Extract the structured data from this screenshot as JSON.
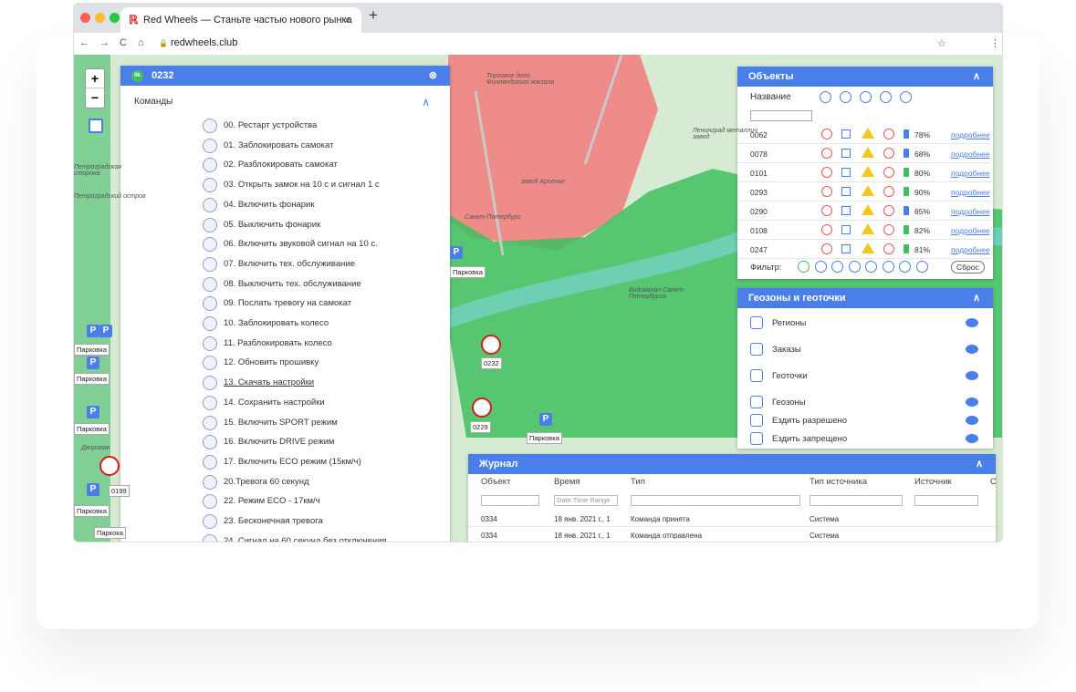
{
  "browser": {
    "tab_title": "Red Wheels — Станьте частью нового рынка",
    "tab_close": "×",
    "new_tab": "+",
    "url": "redwheels.club",
    "nav_back": "←",
    "nav_forward": "→",
    "reload": "C",
    "home": "⌂",
    "lock": "🔒",
    "star": "☆",
    "menu": "⋮"
  },
  "colors": {
    "accent": "#4a7ee8",
    "red_zone": "#f07070",
    "green_zone": "#3fbf5f",
    "map_bg": "#cfe9cf"
  },
  "map": {
    "zoom_in": "+",
    "zoom_out": "−",
    "layers_icon": "layers-icon",
    "labels": [
      "Паркока",
      "Парковка",
      "Парковка",
      "Парковка",
      "Парковка",
      "Парковка",
      "Паркока",
      "Парковка"
    ],
    "devices": [
      "0232",
      "0229",
      "0199"
    ],
    "places": {
      "a": "Торговое депо Финляндского вокзала",
      "b": "Санкт-Петербург",
      "c": "Водоканал Санкт-Петербурга",
      "d": "Ленинград металлич завод",
      "e": "завод Арсенал",
      "f": "Петроградская сторона",
      "g": "Петроградский остров",
      "h": "Дворовая"
    }
  },
  "device_panel": {
    "badge": "0k",
    "title": "0232",
    "close": "⊗",
    "section": "Команды",
    "chev": "∧",
    "commands": [
      "00. Рестарт устройства",
      "01. Заблокировать самокат",
      "02. Разблокировать самокат",
      "03. Открыть замок на 10 с и сигнал 1 с",
      "04. Включить фонарик",
      "05. Выключить фонарик",
      "06. Включить звуковой сигнал на 10 с.",
      "07. Включить тех. обслуживание",
      "08. Выключить тех. обслуживание",
      "09. Послать тревогу на самокат",
      "10. Заблокировать колесо",
      "11. Разблокировать колесо",
      "12. Обновить прошивку",
      "13. Скачать настройки",
      "14. Сохранить настройки",
      "15. Включить SPORT режим",
      "16. Включить DRIVE режим",
      "17. Включить ECO режим (15км/ч)",
      "20.Тревога 60 секунд",
      "22. Режим ECO - 17км/ч",
      "23. Бесконечная тревога",
      "24. Сигнал на 60 секунд без отключения"
    ]
  },
  "objects_panel": {
    "title": "Объекты",
    "chev": "∧",
    "col_name": "Название",
    "filter_label": "Фильтр:",
    "reset": "Сброс",
    "link": "подробнее",
    "rows": [
      {
        "id": "0062",
        "battery": "78%",
        "battery_pct": 78
      },
      {
        "id": "0078",
        "battery": "68%",
        "battery_pct": 68
      },
      {
        "id": "0101",
        "battery": "80%",
        "battery_pct": 80
      },
      {
        "id": "0293",
        "battery": "90%",
        "battery_pct": 90
      },
      {
        "id": "0290",
        "battery": "65%",
        "battery_pct": 65
      },
      {
        "id": "0108",
        "battery": "82%",
        "battery_pct": 82
      },
      {
        "id": "0247",
        "battery": "81%",
        "battery_pct": 81
      }
    ]
  },
  "geo_panel": {
    "title": "Геозоны и геоточки",
    "chev": "∧",
    "items": [
      "Регионы",
      "Заказы",
      "Геоточки",
      "Геозоны",
      "Ездить разрешено",
      "Ездить запрещено"
    ]
  },
  "journal": {
    "title": "Журнал",
    "chev": "∧",
    "cols": [
      "Объект",
      "Время",
      "Тип",
      "Тип источника",
      "Источник",
      "С"
    ],
    "date_placeholder": "Date Time Range",
    "rows": [
      {
        "obj": "0334",
        "time": "18 янв. 2021 г., 1",
        "type": "Команда принята",
        "src_type": "Система"
      },
      {
        "obj": "0334",
        "time": "18 янв. 2021 г., 1",
        "type": "Команда отправлена",
        "src_type": "Система"
      }
    ]
  }
}
